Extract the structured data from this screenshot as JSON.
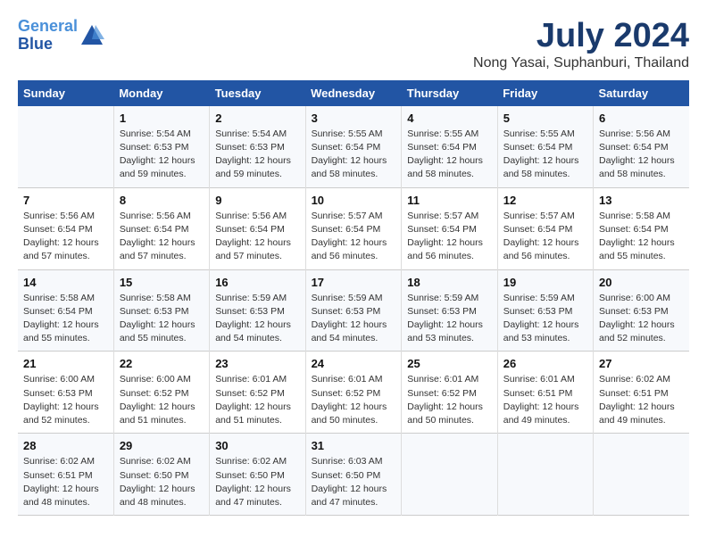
{
  "header": {
    "logo_line1": "General",
    "logo_line2": "Blue",
    "month": "July 2024",
    "location": "Nong Yasai, Suphanburi, Thailand"
  },
  "days_of_week": [
    "Sunday",
    "Monday",
    "Tuesday",
    "Wednesday",
    "Thursday",
    "Friday",
    "Saturday"
  ],
  "weeks": [
    [
      {
        "day": "",
        "info": ""
      },
      {
        "day": "1",
        "info": "Sunrise: 5:54 AM\nSunset: 6:53 PM\nDaylight: 12 hours\nand 59 minutes."
      },
      {
        "day": "2",
        "info": "Sunrise: 5:54 AM\nSunset: 6:53 PM\nDaylight: 12 hours\nand 59 minutes."
      },
      {
        "day": "3",
        "info": "Sunrise: 5:55 AM\nSunset: 6:54 PM\nDaylight: 12 hours\nand 58 minutes."
      },
      {
        "day": "4",
        "info": "Sunrise: 5:55 AM\nSunset: 6:54 PM\nDaylight: 12 hours\nand 58 minutes."
      },
      {
        "day": "5",
        "info": "Sunrise: 5:55 AM\nSunset: 6:54 PM\nDaylight: 12 hours\nand 58 minutes."
      },
      {
        "day": "6",
        "info": "Sunrise: 5:56 AM\nSunset: 6:54 PM\nDaylight: 12 hours\nand 58 minutes."
      }
    ],
    [
      {
        "day": "7",
        "info": "Sunrise: 5:56 AM\nSunset: 6:54 PM\nDaylight: 12 hours\nand 57 minutes."
      },
      {
        "day": "8",
        "info": "Sunrise: 5:56 AM\nSunset: 6:54 PM\nDaylight: 12 hours\nand 57 minutes."
      },
      {
        "day": "9",
        "info": "Sunrise: 5:56 AM\nSunset: 6:54 PM\nDaylight: 12 hours\nand 57 minutes."
      },
      {
        "day": "10",
        "info": "Sunrise: 5:57 AM\nSunset: 6:54 PM\nDaylight: 12 hours\nand 56 minutes."
      },
      {
        "day": "11",
        "info": "Sunrise: 5:57 AM\nSunset: 6:54 PM\nDaylight: 12 hours\nand 56 minutes."
      },
      {
        "day": "12",
        "info": "Sunrise: 5:57 AM\nSunset: 6:54 PM\nDaylight: 12 hours\nand 56 minutes."
      },
      {
        "day": "13",
        "info": "Sunrise: 5:58 AM\nSunset: 6:54 PM\nDaylight: 12 hours\nand 55 minutes."
      }
    ],
    [
      {
        "day": "14",
        "info": "Sunrise: 5:58 AM\nSunset: 6:54 PM\nDaylight: 12 hours\nand 55 minutes."
      },
      {
        "day": "15",
        "info": "Sunrise: 5:58 AM\nSunset: 6:53 PM\nDaylight: 12 hours\nand 55 minutes."
      },
      {
        "day": "16",
        "info": "Sunrise: 5:59 AM\nSunset: 6:53 PM\nDaylight: 12 hours\nand 54 minutes."
      },
      {
        "day": "17",
        "info": "Sunrise: 5:59 AM\nSunset: 6:53 PM\nDaylight: 12 hours\nand 54 minutes."
      },
      {
        "day": "18",
        "info": "Sunrise: 5:59 AM\nSunset: 6:53 PM\nDaylight: 12 hours\nand 53 minutes."
      },
      {
        "day": "19",
        "info": "Sunrise: 5:59 AM\nSunset: 6:53 PM\nDaylight: 12 hours\nand 53 minutes."
      },
      {
        "day": "20",
        "info": "Sunrise: 6:00 AM\nSunset: 6:53 PM\nDaylight: 12 hours\nand 52 minutes."
      }
    ],
    [
      {
        "day": "21",
        "info": "Sunrise: 6:00 AM\nSunset: 6:53 PM\nDaylight: 12 hours\nand 52 minutes."
      },
      {
        "day": "22",
        "info": "Sunrise: 6:00 AM\nSunset: 6:52 PM\nDaylight: 12 hours\nand 51 minutes."
      },
      {
        "day": "23",
        "info": "Sunrise: 6:01 AM\nSunset: 6:52 PM\nDaylight: 12 hours\nand 51 minutes."
      },
      {
        "day": "24",
        "info": "Sunrise: 6:01 AM\nSunset: 6:52 PM\nDaylight: 12 hours\nand 50 minutes."
      },
      {
        "day": "25",
        "info": "Sunrise: 6:01 AM\nSunset: 6:52 PM\nDaylight: 12 hours\nand 50 minutes."
      },
      {
        "day": "26",
        "info": "Sunrise: 6:01 AM\nSunset: 6:51 PM\nDaylight: 12 hours\nand 49 minutes."
      },
      {
        "day": "27",
        "info": "Sunrise: 6:02 AM\nSunset: 6:51 PM\nDaylight: 12 hours\nand 49 minutes."
      }
    ],
    [
      {
        "day": "28",
        "info": "Sunrise: 6:02 AM\nSunset: 6:51 PM\nDaylight: 12 hours\nand 48 minutes."
      },
      {
        "day": "29",
        "info": "Sunrise: 6:02 AM\nSunset: 6:50 PM\nDaylight: 12 hours\nand 48 minutes."
      },
      {
        "day": "30",
        "info": "Sunrise: 6:02 AM\nSunset: 6:50 PM\nDaylight: 12 hours\nand 47 minutes."
      },
      {
        "day": "31",
        "info": "Sunrise: 6:03 AM\nSunset: 6:50 PM\nDaylight: 12 hours\nand 47 minutes."
      },
      {
        "day": "",
        "info": ""
      },
      {
        "day": "",
        "info": ""
      },
      {
        "day": "",
        "info": ""
      }
    ]
  ]
}
